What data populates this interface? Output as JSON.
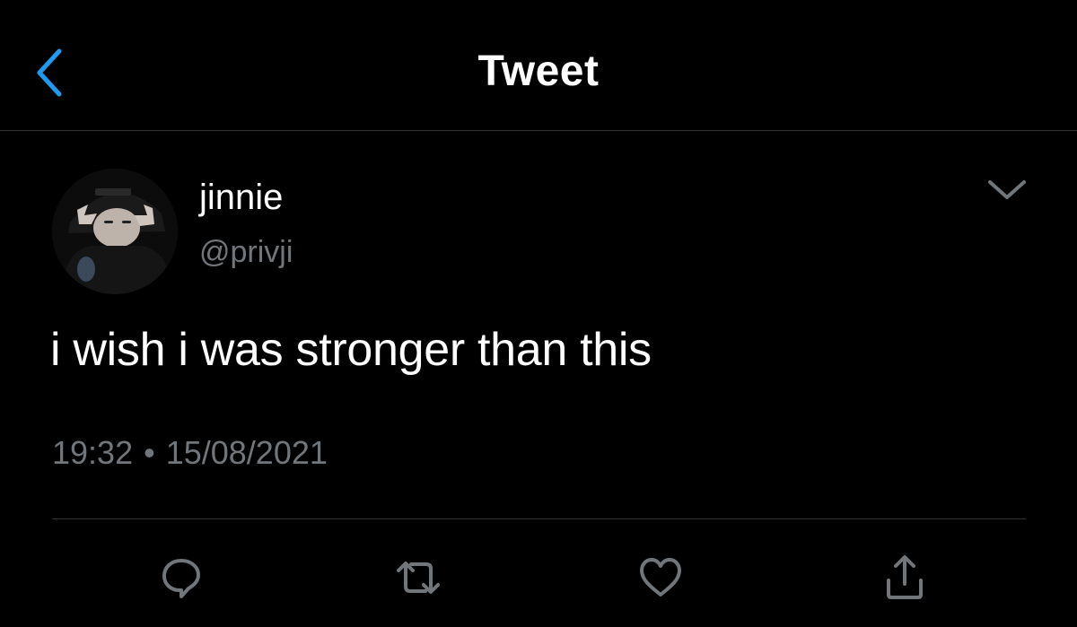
{
  "header": {
    "title": "Tweet",
    "back_icon": "chevron-left-icon",
    "accent_color": "#1d9bf0"
  },
  "tweet": {
    "author": {
      "display_name": "jinnie",
      "handle": "@privji"
    },
    "text": "i wish i was stronger than this",
    "time": "19:32",
    "separator": "•",
    "date": "15/08/2021",
    "more_icon": "chevron-down-icon"
  },
  "actions": [
    {
      "icon": "reply-icon"
    },
    {
      "icon": "retweet-icon"
    },
    {
      "icon": "like-icon"
    },
    {
      "icon": "share-icon"
    }
  ],
  "colors": {
    "background": "#000000",
    "text": "#ffffff",
    "secondary_text": "#71767b",
    "divider": "#2f3336"
  }
}
